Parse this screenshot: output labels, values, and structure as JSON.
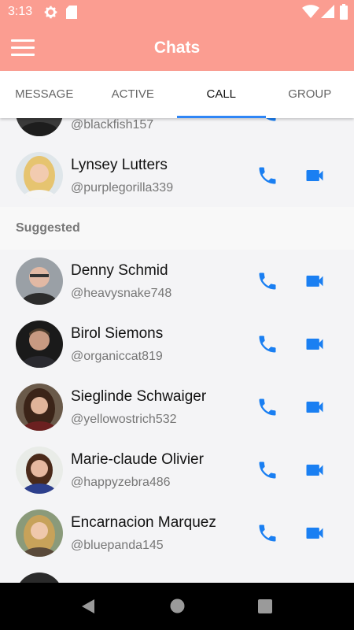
{
  "status_bar": {
    "time": "3:13",
    "left_icons": [
      "gear-icon",
      "sd-card-icon"
    ],
    "right_icons": [
      "wifi-icon",
      "cell-signal-icon",
      "battery-icon"
    ]
  },
  "app_bar": {
    "title": "Chats",
    "menu_icon": "hamburger-menu-icon"
  },
  "tabs": [
    {
      "label": "MESSAGE",
      "active": false
    },
    {
      "label": "ACTIVE",
      "active": false
    },
    {
      "label": "CALL",
      "active": true
    },
    {
      "label": "GROUP",
      "active": false
    }
  ],
  "colors": {
    "primary": "#fb9d91",
    "accent": "#1a7ff2",
    "tab_indicator": "#2f86f6"
  },
  "partial_top_contact": {
    "handle": "@blackfish157"
  },
  "contacts": [
    {
      "name": "Lynsey Lutters",
      "handle": "@purplegorilla339"
    }
  ],
  "suggested": {
    "label": "Suggested",
    "contacts": [
      {
        "name": "Denny Schmid",
        "handle": "@heavysnake748"
      },
      {
        "name": "Birol Siemons",
        "handle": "@organiccat819"
      },
      {
        "name": "Sieglinde Schwaiger",
        "handle": "@yellowostrich532"
      },
      {
        "name": "Marie-claude Olivier",
        "handle": "@happyzebra486"
      },
      {
        "name": "Encarnacion Marquez",
        "handle": "@bluepanda145"
      }
    ]
  },
  "nav_bar": [
    "back-icon",
    "home-icon",
    "recents-icon"
  ]
}
